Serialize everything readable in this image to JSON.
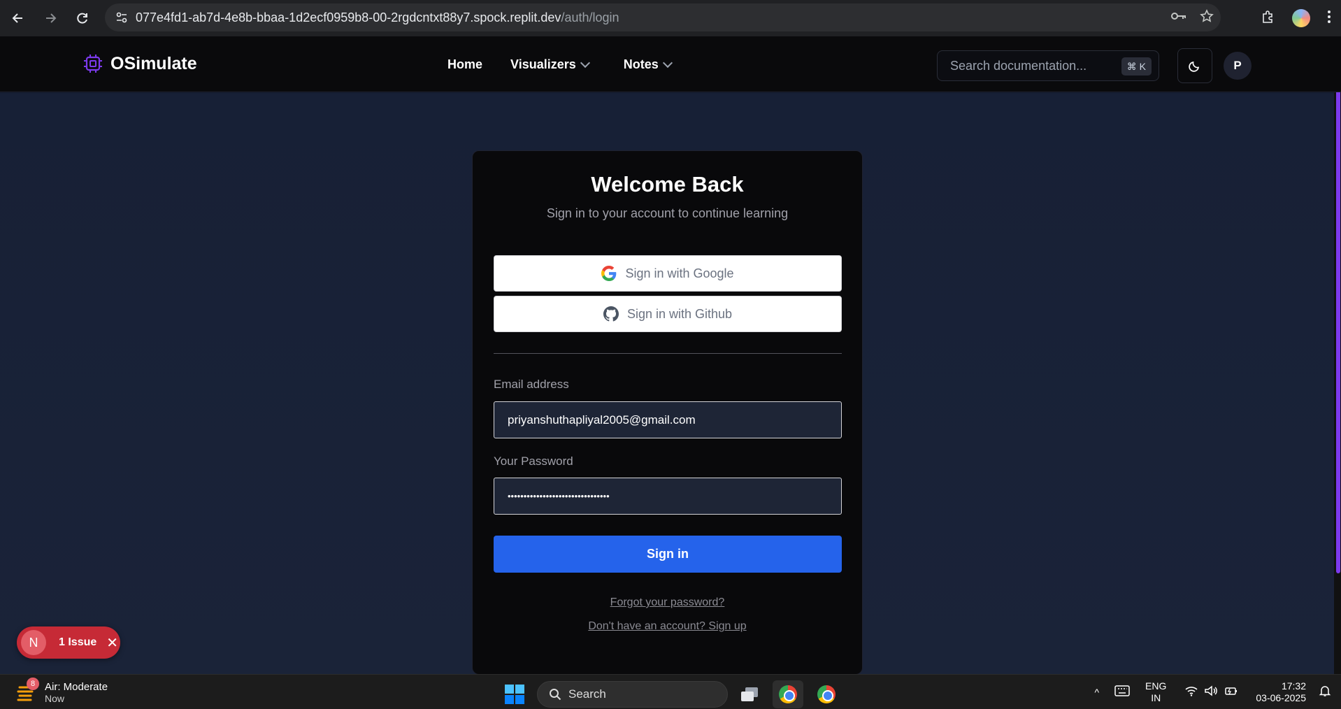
{
  "browser": {
    "url_host": "077e4fd1-ab7d-4e8b-bbaa-1d2ecf0959b8-00-2rgdcntxt88y7.spock.replit.dev",
    "url_path": "/auth/login"
  },
  "header": {
    "brand": "OSimulate",
    "nav": [
      {
        "label": "Home"
      },
      {
        "label": "Visualizers"
      },
      {
        "label": "Notes"
      }
    ],
    "search_placeholder": "Search documentation...",
    "search_shortcut": "⌘ K",
    "user_initial": "P"
  },
  "login": {
    "title": "Welcome Back",
    "subtitle": "Sign in to your account to continue learning",
    "google_label": "Sign in with Google",
    "github_label": "Sign in with Github",
    "email_label": "Email address",
    "email_value": "priyanshuthapliyal2005@gmail.com",
    "password_label": "Your Password",
    "password_value": "••••••••••••••••••••••••••••••••",
    "submit_label": "Sign in",
    "forgot_link": "Forgot your password?",
    "signup_link": "Don't have an account? Sign up"
  },
  "issue": {
    "initial": "N",
    "text": "1 Issue"
  },
  "taskbar": {
    "weather_title": "Air: Moderate",
    "weather_sub": "Now",
    "weather_badge": "8",
    "search_label": "Search",
    "lang_top": "ENG",
    "lang_bottom": "IN",
    "time": "17:32",
    "date": "03-06-2025"
  },
  "colors": {
    "accent": "#2563eb",
    "brand_icon": "#7c3aed",
    "issue": "#c62a36"
  }
}
